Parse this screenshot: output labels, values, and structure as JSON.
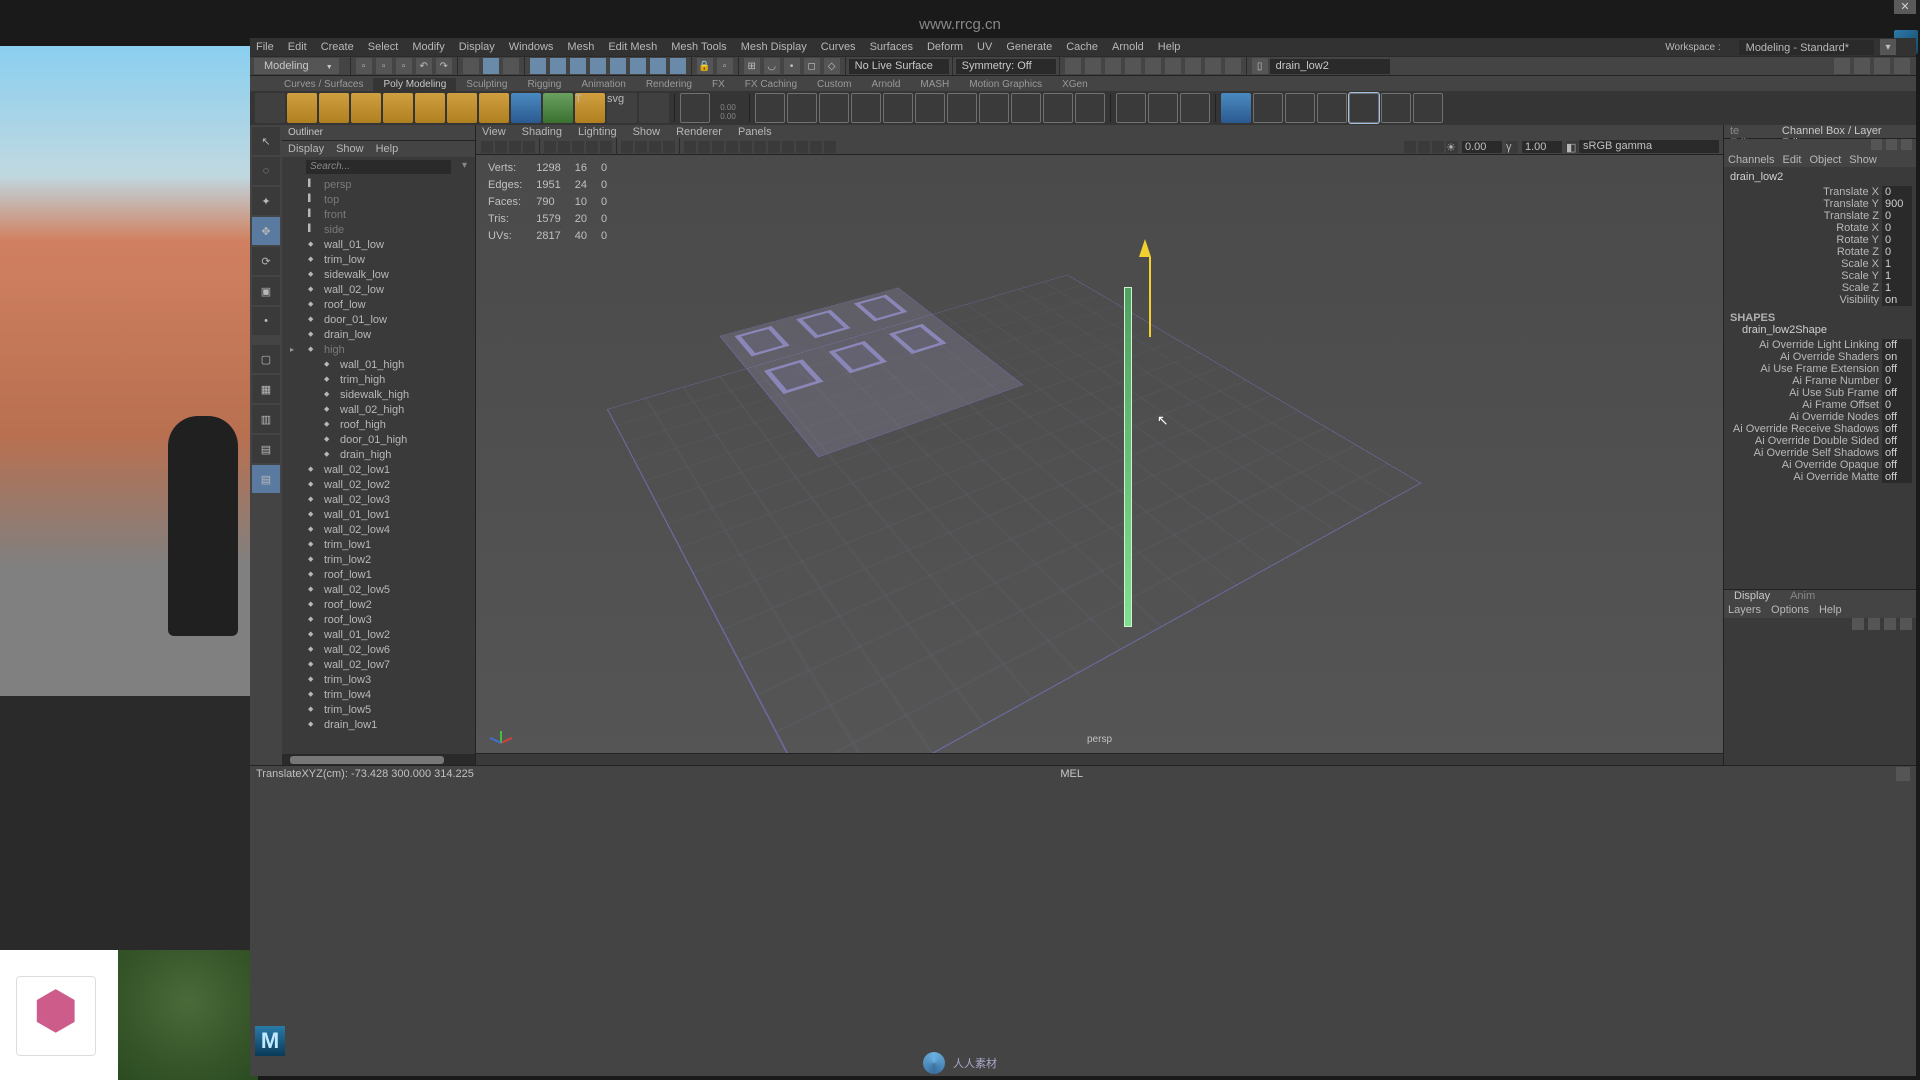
{
  "watermark_top": "www.rrcg.cn",
  "watermark_bottom": "人人素材",
  "menubar": [
    "File",
    "Edit",
    "Create",
    "Select",
    "Modify",
    "Display",
    "Windows",
    "Mesh",
    "Edit Mesh",
    "Mesh Tools",
    "Mesh Display",
    "Curves",
    "Surfaces",
    "Deform",
    "UV",
    "Generate",
    "Cache",
    "Arnold",
    "Help"
  ],
  "workspace": {
    "label": "Workspace :",
    "value": "Modeling - Standard*"
  },
  "mode_dropdown": "Modeling",
  "status_fields": {
    "no_live_surface": "No Live Surface",
    "symmetry": "Symmetry: Off",
    "node_name": "drain_low2"
  },
  "shelf_tabs": [
    "Curves / Surfaces",
    "Poly Modeling",
    "Sculpting",
    "Rigging",
    "Animation",
    "Rendering",
    "FX",
    "FX Caching",
    "Custom",
    "Arnold",
    "MASH",
    "Motion Graphics",
    "XGen"
  ],
  "shelf_tool_label": "0.00\n0.00",
  "outliner": {
    "title": "Outliner",
    "menubar": [
      "Display",
      "Show",
      "Help"
    ],
    "search_placeholder": "Search...",
    "nodes": [
      {
        "name": "persp",
        "cam": true,
        "hid": true
      },
      {
        "name": "top",
        "cam": true,
        "hid": true
      },
      {
        "name": "front",
        "cam": true,
        "hid": true
      },
      {
        "name": "side",
        "cam": true,
        "hid": true
      },
      {
        "name": "wall_01_low"
      },
      {
        "name": "trim_low"
      },
      {
        "name": "sidewalk_low"
      },
      {
        "name": "wall_02_low"
      },
      {
        "name": "roof_low"
      },
      {
        "name": "door_01_low"
      },
      {
        "name": "drain_low"
      },
      {
        "name": "high",
        "hid": true,
        "group": true
      },
      {
        "name": "wall_01_high",
        "nested": true
      },
      {
        "name": "trim_high",
        "nested": true
      },
      {
        "name": "sidewalk_high",
        "nested": true
      },
      {
        "name": "wall_02_high",
        "nested": true
      },
      {
        "name": "roof_high",
        "nested": true
      },
      {
        "name": "door_01_high",
        "nested": true
      },
      {
        "name": "drain_high",
        "nested": true
      },
      {
        "name": "wall_02_low1"
      },
      {
        "name": "wall_02_low2"
      },
      {
        "name": "wall_02_low3"
      },
      {
        "name": "wall_01_low1"
      },
      {
        "name": "wall_02_low4"
      },
      {
        "name": "trim_low1"
      },
      {
        "name": "trim_low2"
      },
      {
        "name": "roof_low1"
      },
      {
        "name": "wall_02_low5"
      },
      {
        "name": "roof_low2"
      },
      {
        "name": "roof_low3"
      },
      {
        "name": "wall_01_low2"
      },
      {
        "name": "wall_02_low6"
      },
      {
        "name": "wall_02_low7"
      },
      {
        "name": "trim_low3"
      },
      {
        "name": "trim_low4"
      },
      {
        "name": "trim_low5"
      },
      {
        "name": "drain_low1"
      }
    ]
  },
  "viewport": {
    "menubar": [
      "View",
      "Shading",
      "Lighting",
      "Show",
      "Renderer",
      "Panels"
    ],
    "num1": "0.00",
    "num2": "1.00",
    "colorspace": "sRGB gamma",
    "camera_name": "persp",
    "hud": {
      "rows": [
        {
          "label": "Verts:",
          "col2": "1298",
          "col3": "16",
          "col4": "0"
        },
        {
          "label": "Edges:",
          "col2": "1951",
          "col3": "24",
          "col4": "0"
        },
        {
          "label": "Faces:",
          "col2": "790",
          "col3": "10",
          "col4": "0"
        },
        {
          "label": "Tris:",
          "col2": "1579",
          "col3": "20",
          "col4": "0"
        },
        {
          "label": "UVs:",
          "col2": "2817",
          "col3": "40",
          "col4": "0"
        }
      ]
    }
  },
  "channelbox": {
    "tabs_right": [
      "te Editor",
      "Channel Box / Layer Editor"
    ],
    "menubar": [
      "Channels",
      "Edit",
      "Object",
      "Show"
    ],
    "node": "drain_low2",
    "shape_label": "SHAPES",
    "shape_name": "drain_low2Shape",
    "channels": [
      {
        "label": "Translate X",
        "value": "0"
      },
      {
        "label": "Translate Y",
        "value": "900"
      },
      {
        "label": "Translate Z",
        "value": "0"
      },
      {
        "label": "Rotate X",
        "value": "0"
      },
      {
        "label": "Rotate Y",
        "value": "0"
      },
      {
        "label": "Rotate Z",
        "value": "0"
      },
      {
        "label": "Scale X",
        "value": "1"
      },
      {
        "label": "Scale Y",
        "value": "1"
      },
      {
        "label": "Scale Z",
        "value": "1"
      },
      {
        "label": "Visibility",
        "value": "on"
      }
    ],
    "shape_attrs": [
      {
        "label": "Ai Override Light Linking",
        "value": "off"
      },
      {
        "label": "Ai Override Shaders",
        "value": "on"
      },
      {
        "label": "Ai Use Frame Extension",
        "value": "off"
      },
      {
        "label": "Ai Frame Number",
        "value": "0"
      },
      {
        "label": "Ai Use Sub Frame",
        "value": "off"
      },
      {
        "label": "Ai Frame Offset",
        "value": "0"
      },
      {
        "label": "Ai Override Nodes",
        "value": "off"
      },
      {
        "label": "Ai Override Receive Shadows",
        "value": "off"
      },
      {
        "label": "Ai Override Double Sided",
        "value": "off"
      },
      {
        "label": "Ai Override Self Shadows",
        "value": "off"
      },
      {
        "label": "Ai Override Opaque",
        "value": "off"
      },
      {
        "label": "Ai Override Matte",
        "value": "off"
      }
    ]
  },
  "layers": {
    "tabs": [
      "Display",
      "Anim"
    ],
    "menubar": [
      "Layers",
      "Options",
      "Help"
    ]
  },
  "statusbar": {
    "left": "TranslateXYZ(cm):    -73.428      300.000      314.225",
    "mel": "MEL"
  }
}
